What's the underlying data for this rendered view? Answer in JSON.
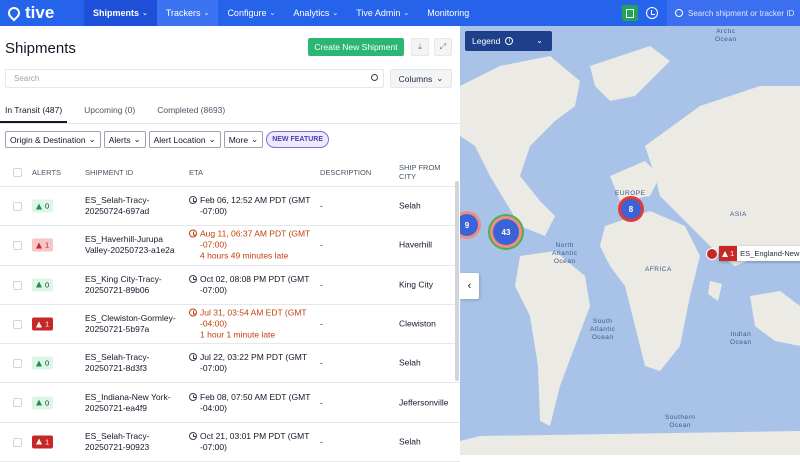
{
  "brand": "tive",
  "nav": [
    {
      "label": "Shipments",
      "chevron": "⌄"
    },
    {
      "label": "Trackers",
      "chevron": "⌄"
    },
    {
      "label": "Configure",
      "chevron": "⌄"
    },
    {
      "label": "Analytics",
      "chevron": "⌄"
    },
    {
      "label": "Tive Admin",
      "chevron": "⌄"
    },
    {
      "label": "Monitoring",
      "chevron": ""
    }
  ],
  "search": {
    "placeholder": "Search shipment or tracker ID"
  },
  "page": {
    "title": "Shipments",
    "create_label": "Create New Shipment",
    "search_placeholder": "Search",
    "columns_label": "Columns"
  },
  "tabs": [
    {
      "label": "In Transit (487)"
    },
    {
      "label": "Upcoming (0)"
    },
    {
      "label": "Completed (8693)"
    }
  ],
  "filters": [
    {
      "label": "Origin & Destination"
    },
    {
      "label": "Alerts"
    },
    {
      "label": "Alert Location"
    },
    {
      "label": "More"
    }
  ],
  "new_feature": "NEW FEATURE",
  "columns": {
    "alerts": "ALERTS",
    "shipment_id": "SHIPMENT ID",
    "eta": "ETA",
    "description": "DESCRIPTION",
    "ship_from_city": "SHIP FROM CITY"
  },
  "rows": [
    {
      "alert_count": "0",
      "alert_style": "ok",
      "id": "ES_Selah-Tracy-20250724-697ad",
      "eta": "Feb 06, 12:52 AM PDT (GMT -07:00)",
      "late": "",
      "description": "-",
      "city": "Selah"
    },
    {
      "alert_count": "1",
      "alert_style": "soft",
      "id": "ES_Haverhill-Jurupa Valley-20250723-a1e2a",
      "eta": "Aug 11, 06:37 AM PDT (GMT -07:00)",
      "late": "4 hours 49 minutes late",
      "description": "-",
      "city": "Haverhill"
    },
    {
      "alert_count": "0",
      "alert_style": "ok",
      "id": "ES_King City-Tracy-20250721-89b06",
      "eta": "Oct 02, 08:08 PM PDT (GMT -07:00)",
      "late": "",
      "description": "-",
      "city": "King City"
    },
    {
      "alert_count": "1",
      "alert_style": "alert",
      "id": "ES_Clewiston-Gormley-20250721-5b97a",
      "eta": "Jul 31, 03:54 AM EDT (GMT -04:00)",
      "late": "1 hour 1 minute late",
      "description": "-",
      "city": "Clewiston"
    },
    {
      "alert_count": "0",
      "alert_style": "ok",
      "id": "ES_Selah-Tracy-20250721-8d3f3",
      "eta": "Jul 22, 03:22 PM PDT (GMT -07:00)",
      "late": "",
      "description": "-",
      "city": "Selah"
    },
    {
      "alert_count": "0",
      "alert_style": "ok",
      "id": "ES_Indiana-New York-20250721-ea4f9",
      "eta": "Feb 08, 07:50 AM EDT (GMT -04:00)",
      "late": "",
      "description": "-",
      "city": "Jeffersonville"
    },
    {
      "alert_count": "1",
      "alert_style": "alert",
      "id": "ES_Selah-Tracy-20250721-90923",
      "eta": "Oct 21, 03:01 PM PDT (GMT -07:00)",
      "late": "",
      "description": "-",
      "city": "Selah"
    }
  ],
  "map": {
    "legend_label": "Legend",
    "clusters": [
      "9",
      "43",
      "8"
    ],
    "pin_alert_count": "1",
    "pin_label": "ES_England-New S",
    "labels": {
      "arctic_ocean": "Arctic\nOcean",
      "north_atlantic": "North\nAtlantic\nOcean",
      "south_atlantic": "South\nAtlantic\nOcean",
      "indian_ocean": "Indian\nOcean",
      "southern_ocean": "Southern\nOcean",
      "asia": "ASIA",
      "africa": "AFRICA",
      "europe": "EUROPE"
    }
  },
  "colors": {
    "primary": "#2563eb",
    "create": "#2bb673",
    "alert": "#c62828",
    "ok": "#dcf5e4",
    "legend": "#1e3f8a"
  }
}
